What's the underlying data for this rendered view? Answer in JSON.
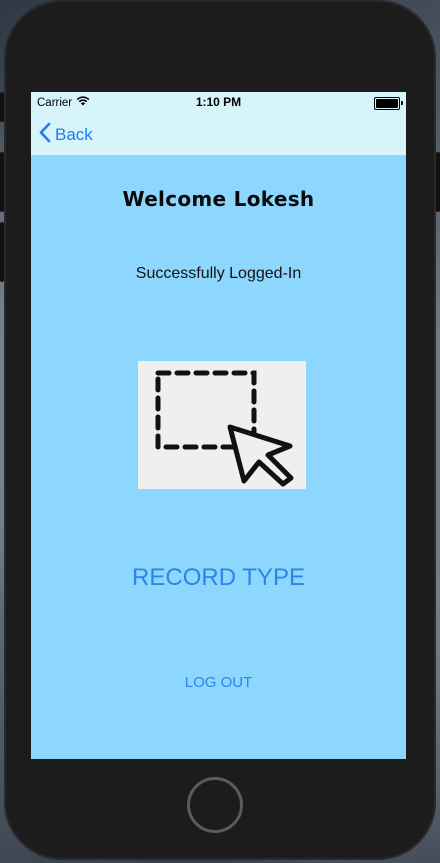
{
  "status_bar": {
    "carrier": "Carrier",
    "time": "1:10 PM",
    "wifi_icon": "wifi-icon",
    "battery_icon": "battery-icon"
  },
  "nav": {
    "back_label": "Back",
    "back_icon": "chevron-left-icon"
  },
  "main": {
    "welcome_text": "Welcome Lokesh",
    "status_text": "Successfully Logged-In",
    "image_icon": "selection-cursor-icon",
    "record_button_label": "RECORD TYPE",
    "logout_button_label": "LOG OUT"
  },
  "colors": {
    "screen_background": "#8dd6fd",
    "bar_background": "#d8f4fb",
    "accent": "#2a86e8",
    "image_background": "#efefef"
  }
}
